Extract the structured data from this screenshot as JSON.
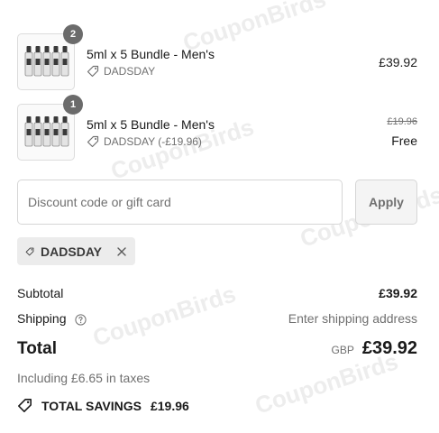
{
  "cart": {
    "items": [
      {
        "quantity": "2",
        "title": "5ml x 5 Bundle - Men's",
        "discount": "DADSDAY",
        "price": "£39.92",
        "icon": "bottles-thumbnail"
      },
      {
        "quantity": "1",
        "title": "5ml x 5 Bundle - Men's",
        "discount": "DADSDAY (-£19.96)",
        "original_price": "£19.96",
        "price": "Free",
        "icon": "bottles-thumbnail"
      }
    ]
  },
  "discount": {
    "placeholder": "Discount code or gift card",
    "apply_label": "Apply",
    "applied_code": "DADSDAY"
  },
  "summary": {
    "subtotal_label": "Subtotal",
    "subtotal_value": "£39.92",
    "shipping_label": "Shipping",
    "shipping_value": "Enter shipping address",
    "total_label": "Total",
    "currency": "GBP",
    "total_value": "£39.92",
    "taxes_text": "Including £6.65 in taxes",
    "savings_label": "TOTAL SAVINGS",
    "savings_value": "£19.96"
  },
  "watermark": "CouponBirds"
}
